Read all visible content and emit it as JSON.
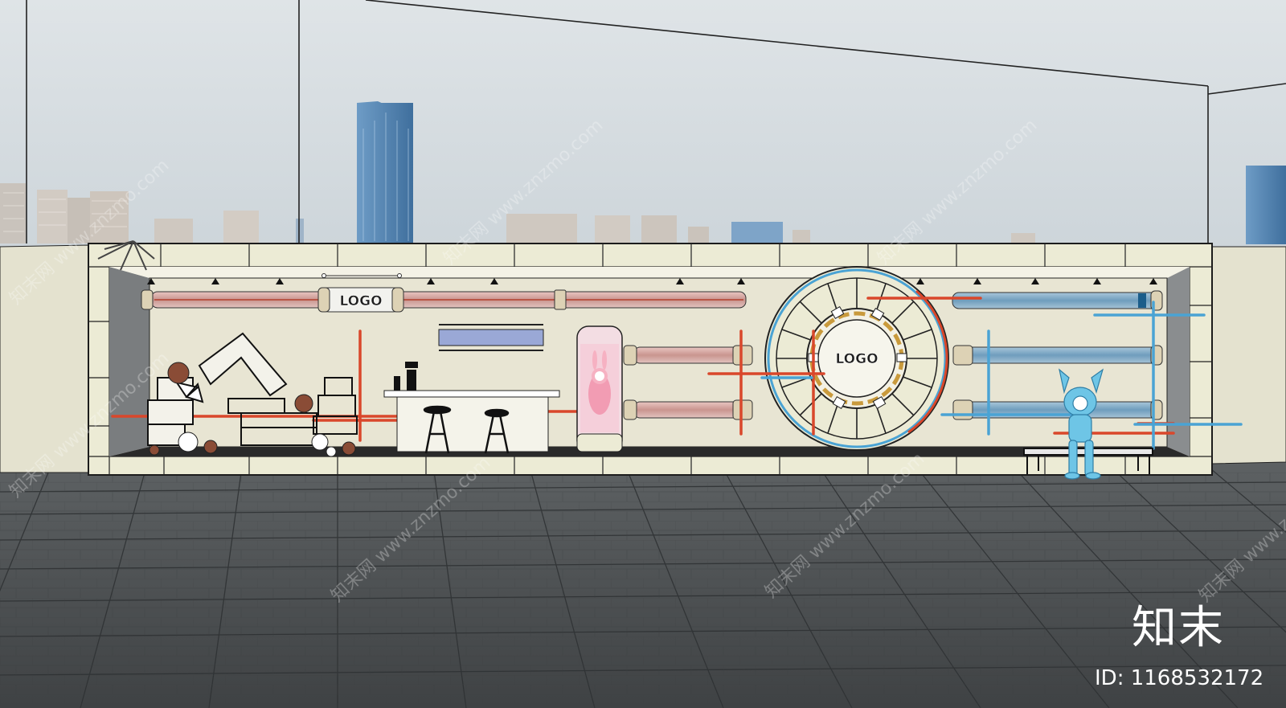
{
  "wall": {
    "logo_left": "LOGO",
    "logo_center": "LOGO"
  },
  "watermark": {
    "text": "知末网 www.znzmo.com"
  },
  "brand": {
    "name": "知末",
    "id_label": "ID: 1168532172"
  },
  "colors": {
    "sky": "#d3dade",
    "wall_cream": "#ecebd5",
    "floor": "#4f5254",
    "red_pipe": "#d9472b",
    "blue_pipe": "#4aa3d4",
    "rabbit_blue": "#6ec5e6",
    "rabbit_pink": "#f2a7b9"
  }
}
